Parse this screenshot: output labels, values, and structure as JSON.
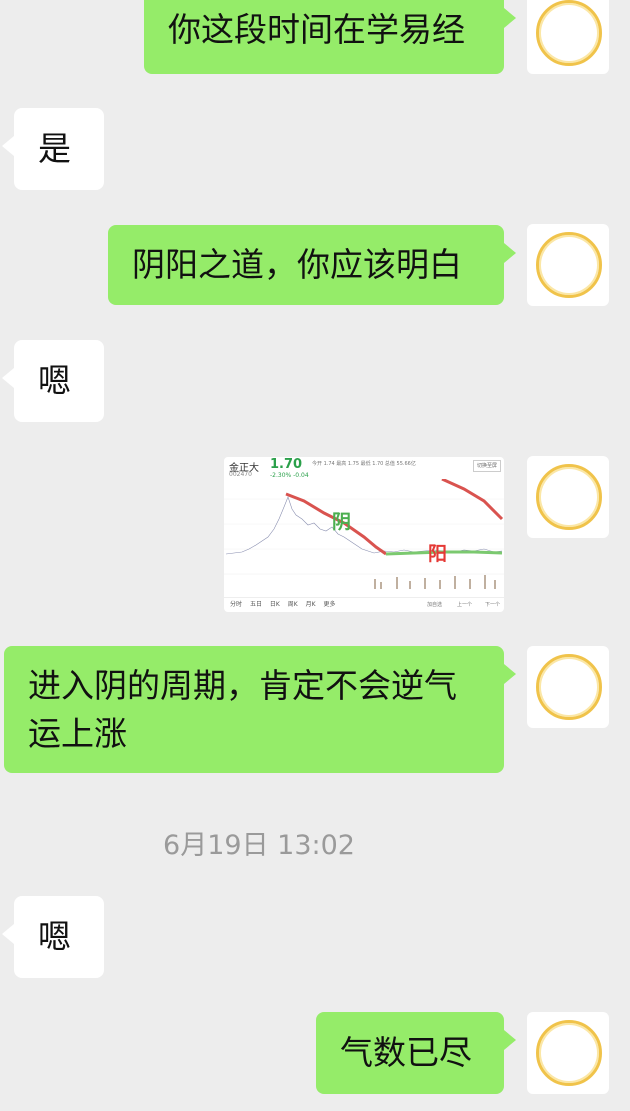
{
  "messages": [
    {
      "side": "me",
      "text": "你这段时间在学易经"
    },
    {
      "side": "other",
      "text": "是"
    },
    {
      "side": "me",
      "text": "阴阳之道，你应该明白"
    },
    {
      "side": "other",
      "text": "嗯"
    },
    {
      "side": "me",
      "type": "image"
    },
    {
      "side": "me",
      "text": "进入阴的周期，肯定不会逆气运上涨"
    },
    {
      "side": "other",
      "text": "嗯"
    },
    {
      "side": "me",
      "text": "气数已尽"
    }
  ],
  "timestamp": "6月19日 13:02",
  "stock_card": {
    "name": "金正大",
    "code": "002470",
    "price": "1.70",
    "change": "-2.30% -0.04",
    "stats": "今开 1.74  最高 1.75  最低 1.70  总值 55.66亿",
    "button": "切换至屏",
    "bottom_tabs": [
      "分时",
      "五日",
      "日K",
      "周K",
      "月K",
      "更多"
    ],
    "bottom_right": [
      "加自选",
      "上一个",
      "下一个"
    ],
    "yin_label": "阴",
    "yang_label": "阳",
    "colors": {
      "price": "#2aa04a",
      "yin": "#4caf50",
      "yang": "#e53935"
    }
  },
  "colors": {
    "me_bubble": "#95ec69",
    "other_bubble": "#ffffff",
    "background": "#ededed"
  }
}
